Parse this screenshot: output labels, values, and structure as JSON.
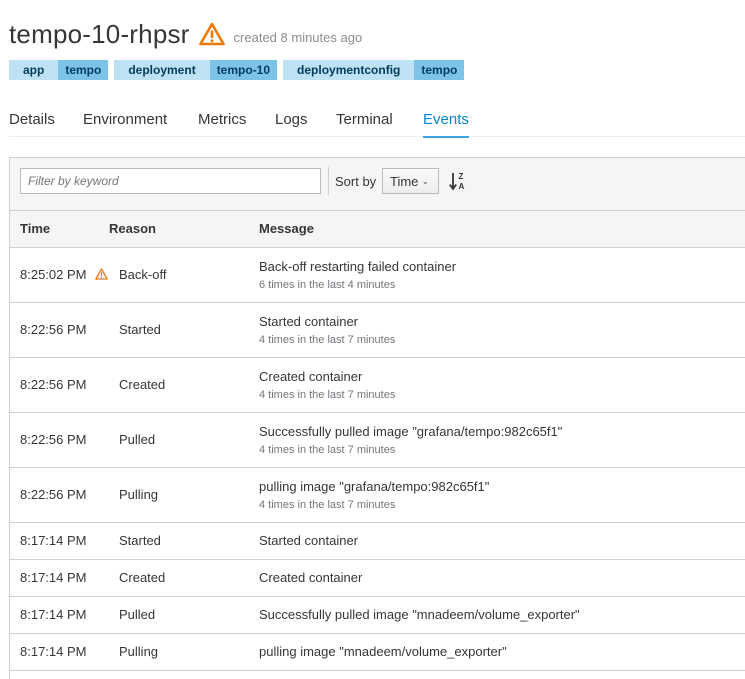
{
  "header": {
    "title": "tempo-10-rhpsr",
    "created": "created 8 minutes ago",
    "warning_color": "#ec7a08"
  },
  "labels": [
    {
      "key": "app",
      "value": "tempo"
    },
    {
      "key": "deployment",
      "value": "tempo-10"
    },
    {
      "key": "deploymentconfig",
      "value": "tempo"
    }
  ],
  "tabs": [
    {
      "label": "Details",
      "active": false
    },
    {
      "label": "Environment",
      "active": false
    },
    {
      "label": "Metrics",
      "active": false
    },
    {
      "label": "Logs",
      "active": false
    },
    {
      "label": "Terminal",
      "active": false
    },
    {
      "label": "Events",
      "active": true
    }
  ],
  "toolbar": {
    "filter_placeholder": "Filter by keyword",
    "sort_label": "Sort by",
    "sort_value": "Time",
    "sort_icon": "sort-alpha-desc-icon"
  },
  "table": {
    "headers": {
      "time": "Time",
      "reason": "Reason",
      "message": "Message"
    },
    "rows": [
      {
        "time": "8:25:02 PM",
        "reason": "Back-off",
        "warning": true,
        "message": "Back-off restarting failed container",
        "count": "6 times in the last 4 minutes"
      },
      {
        "time": "8:22:56 PM",
        "reason": "Started",
        "warning": false,
        "message": "Started container",
        "count": "4 times in the last 7 minutes"
      },
      {
        "time": "8:22:56 PM",
        "reason": "Created",
        "warning": false,
        "message": "Created container",
        "count": "4 times in the last 7 minutes"
      },
      {
        "time": "8:22:56 PM",
        "reason": "Pulled",
        "warning": false,
        "message": "Successfully pulled image \"grafana/tempo:982c65f1\"",
        "count": "4 times in the last 7 minutes"
      },
      {
        "time": "8:22:56 PM",
        "reason": "Pulling",
        "warning": false,
        "message": "pulling image \"grafana/tempo:982c65f1\"",
        "count": "4 times in the last 7 minutes"
      },
      {
        "time": "8:17:14 PM",
        "reason": "Started",
        "warning": false,
        "message": "Started container",
        "count": ""
      },
      {
        "time": "8:17:14 PM",
        "reason": "Created",
        "warning": false,
        "message": "Created container",
        "count": ""
      },
      {
        "time": "8:17:14 PM",
        "reason": "Pulled",
        "warning": false,
        "message": "Successfully pulled image \"mnadeem/volume_exporter\"",
        "count": ""
      },
      {
        "time": "8:17:14 PM",
        "reason": "Pulling",
        "warning": false,
        "message": "pulling image \"mnadeem/volume_exporter\"",
        "count": ""
      }
    ]
  }
}
